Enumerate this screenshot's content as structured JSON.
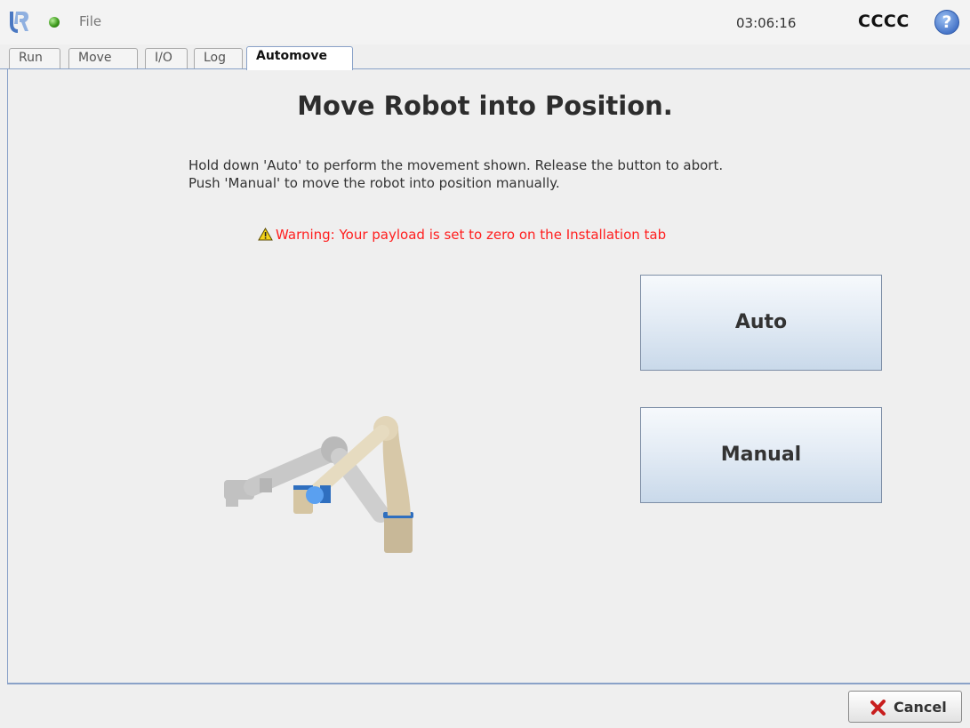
{
  "header": {
    "menu_label": "File",
    "clock": "03:06:16",
    "robot_name": "CCCC",
    "help_label": "?"
  },
  "tabs": [
    {
      "label": "Run"
    },
    {
      "label": "Move"
    },
    {
      "label": "I/O"
    },
    {
      "label": "Log"
    },
    {
      "label": "Automove",
      "active": true
    }
  ],
  "main": {
    "title": "Move Robot into Position.",
    "instructions": [
      "Hold down 'Auto' to perform the movement shown. Release the button to abort.",
      "Push 'Manual' to move the robot into position manually."
    ],
    "warning": "Warning: Your payload is set to zero on the Installation tab",
    "auto_label": "Auto",
    "manual_label": "Manual"
  },
  "footer": {
    "cancel_label": "Cancel"
  },
  "colors": {
    "warning": "#ff1e1e",
    "accent": "#8aa2c8",
    "status_ok": "#3d9a1c"
  },
  "icons": {
    "logo": "ur-logo-icon",
    "status": "status-led-icon",
    "help": "help-icon",
    "warning": "warning-triangle-icon",
    "cancel": "cancel-x-icon"
  }
}
